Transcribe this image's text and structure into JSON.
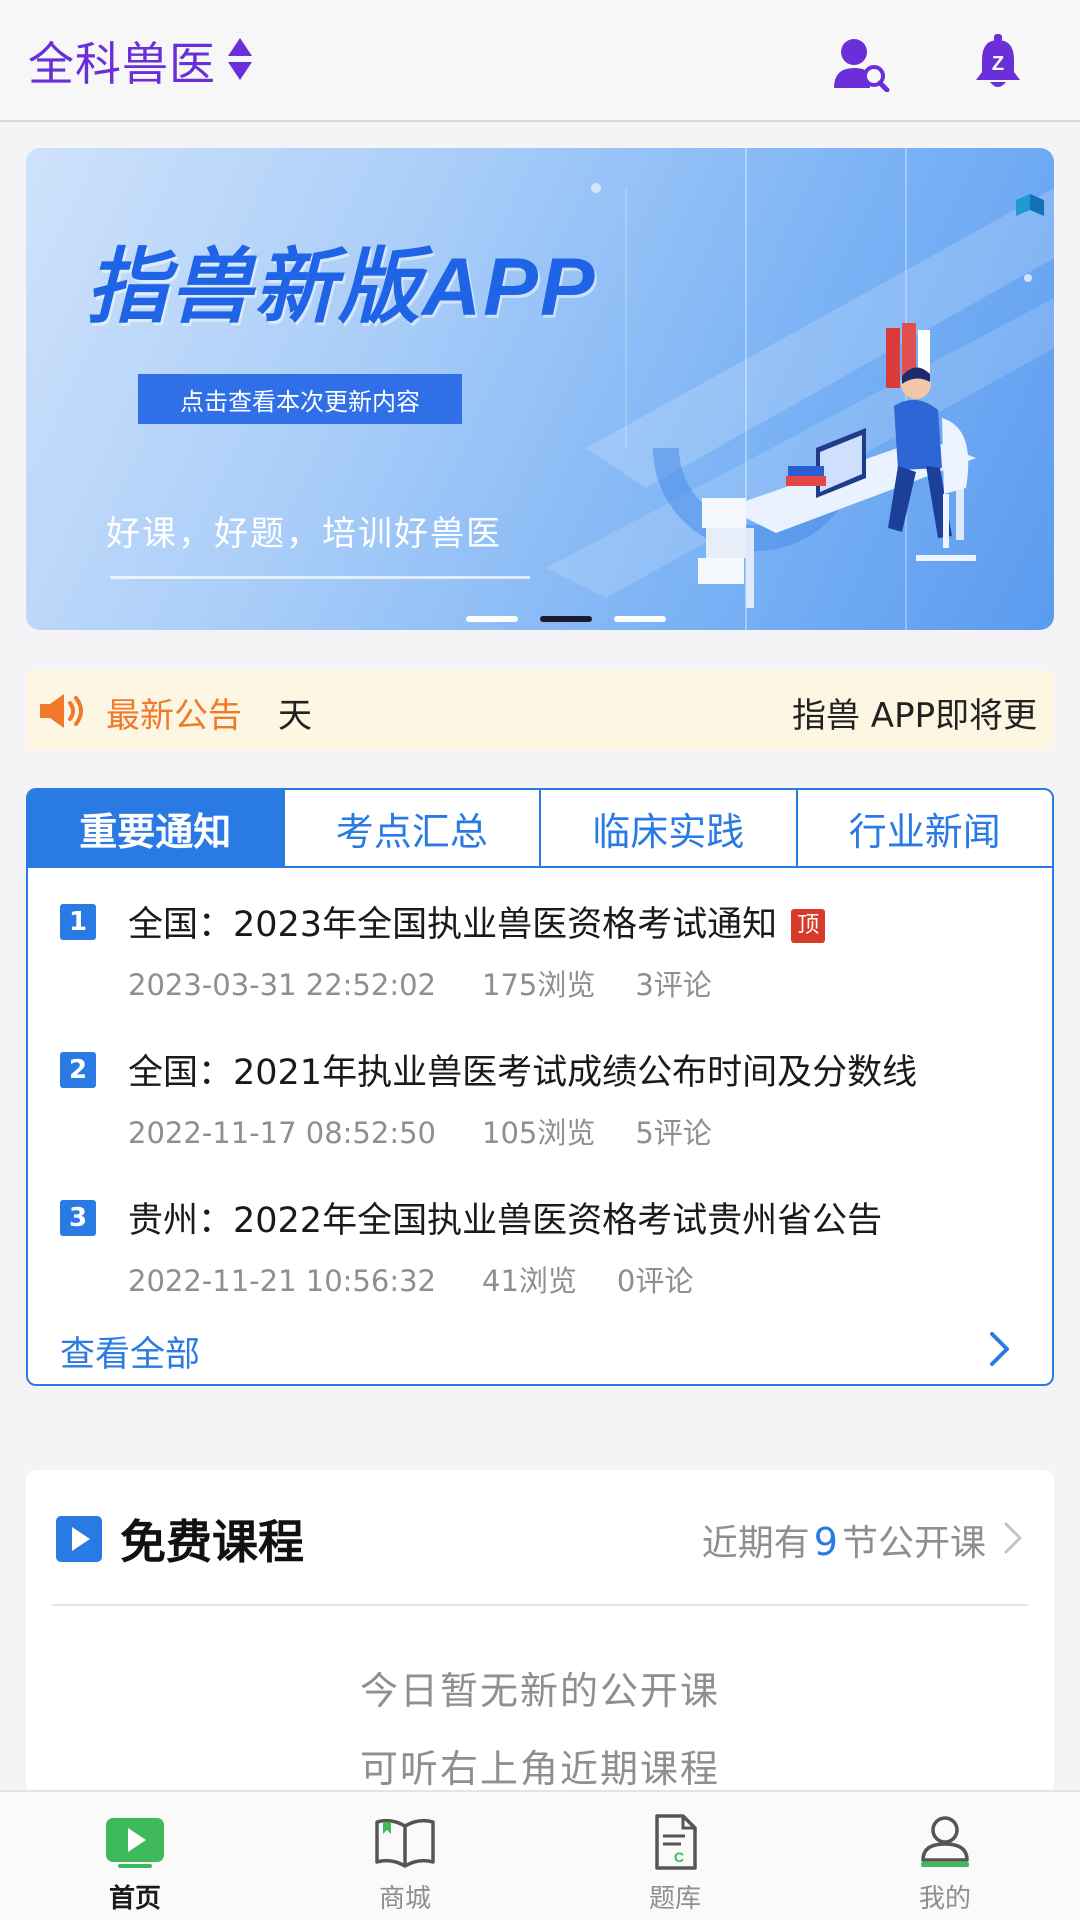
{
  "header": {
    "title": "全科兽医"
  },
  "banner": {
    "headline": "指兽新版APP",
    "cta": "点击查看本次更新内容",
    "slogan": "好课，好题，培训好兽医",
    "slide_count": 3,
    "active_slide": 2
  },
  "announcement": {
    "label": "最新公告",
    "scroll_tail": "天",
    "scroll_text": "指兽 APP即将更"
  },
  "news": {
    "tabs": [
      {
        "label": "重要通知",
        "active": true
      },
      {
        "label": "考点汇总",
        "active": false
      },
      {
        "label": "临床实践",
        "active": false
      },
      {
        "label": "行业新闻",
        "active": false
      }
    ],
    "items": [
      {
        "rank": "1",
        "title": "全国：2023年全国执业兽医资格考试通知",
        "badge": "顶",
        "date": "2023-03-31 22:52:02",
        "views": "175浏览",
        "comments": "3评论"
      },
      {
        "rank": "2",
        "title": "全国：2021年执业兽医考试成绩公布时间及分数线",
        "badge": "",
        "date": "2022-11-17 08:52:50",
        "views": "105浏览",
        "comments": "5评论"
      },
      {
        "rank": "3",
        "title": "贵州：2022年全国执业兽医资格考试贵州省公告",
        "badge": "",
        "date": "2022-11-21 10:56:32",
        "views": "41浏览",
        "comments": "0评论"
      }
    ],
    "view_all": "查看全部"
  },
  "courses": {
    "title": "免费课程",
    "upcoming_prefix": "近期有",
    "upcoming_count": "9",
    "upcoming_suffix": "节公开课",
    "empty_line1": "今日暂无新的公开课",
    "empty_line2": "可听右上角近期课程"
  },
  "bottom_nav": [
    {
      "label": "首页",
      "icon": "home-play-icon",
      "active": true
    },
    {
      "label": "商城",
      "icon": "book-icon",
      "active": false
    },
    {
      "label": "题库",
      "icon": "document-icon",
      "active": false
    },
    {
      "label": "我的",
      "icon": "profile-icon",
      "active": false
    }
  ],
  "colors": {
    "brand_purple": "#6a2fd8",
    "accent_blue": "#2a7ae4",
    "announce_orange": "#f07a2a",
    "badge_red": "#d63a2a",
    "nav_green": "#3fba5a"
  }
}
